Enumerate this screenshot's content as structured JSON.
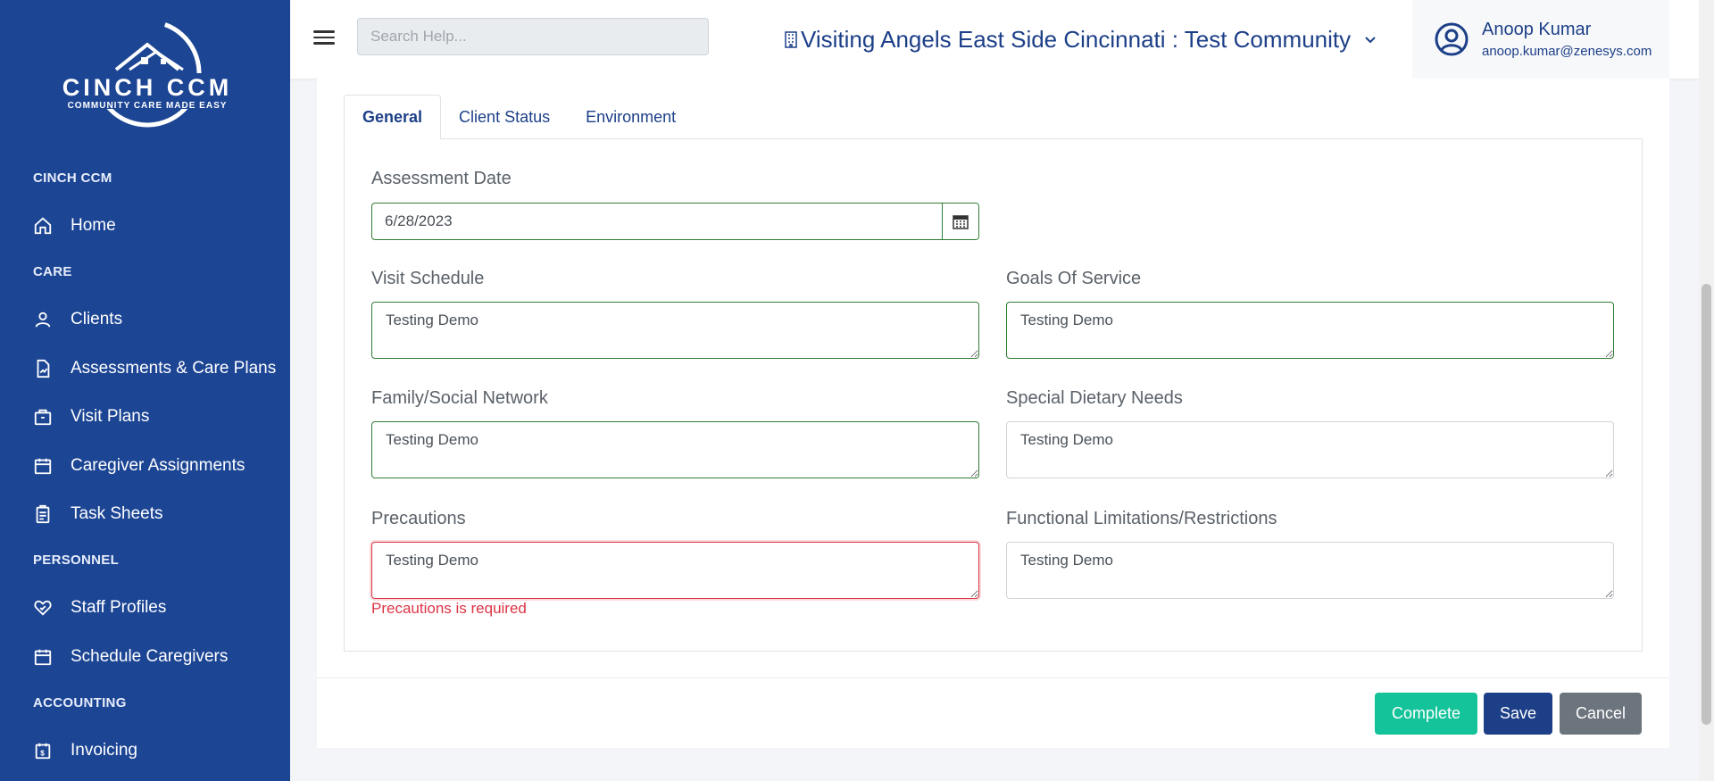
{
  "brand": {
    "logo_name": "CINCH CCM",
    "logo_tagline": "COMMUNITY CARE MADE EASY"
  },
  "sidebar": {
    "sections": {
      "cinch": "CINCH CCM",
      "care": "CARE",
      "personnel": "PERSONNEL",
      "accounting": "ACCOUNTING"
    },
    "items": [
      {
        "label": "Home",
        "icon": "home-icon"
      },
      {
        "label": "Clients",
        "icon": "user-icon"
      },
      {
        "label": "Assessments & Care Plans",
        "icon": "file-chart-icon"
      },
      {
        "label": "Visit Plans",
        "icon": "briefcase-icon"
      },
      {
        "label": "Caregiver Assignments",
        "icon": "calendar-icon"
      },
      {
        "label": "Task Sheets",
        "icon": "clipboard-icon"
      },
      {
        "label": "Staff Profiles",
        "icon": "heart-icon"
      },
      {
        "label": "Schedule Caregivers",
        "icon": "calendar-icon"
      },
      {
        "label": "Invoicing",
        "icon": "invoice-icon"
      }
    ]
  },
  "header": {
    "search_placeholder": "Search Help...",
    "community": "Visiting Angels East Side Cincinnati : Test Community",
    "user_name": "Anoop Kumar",
    "user_email": "anoop.kumar@zenesys.com"
  },
  "tabs": [
    "General",
    "Client Status",
    "Environment"
  ],
  "form": {
    "assessment_date_label": "Assessment Date",
    "assessment_date_value": "6/28/2023",
    "visit_schedule_label": "Visit Schedule",
    "visit_schedule_value": "Testing Demo",
    "goals_label": "Goals Of Service",
    "goals_value": "Testing Demo",
    "family_label": "Family/Social Network",
    "family_value": "Testing Demo",
    "dietary_label": "Special Dietary Needs",
    "dietary_value": "Testing Demo",
    "precautions_label": "Precautions",
    "precautions_value": "Testing Demo",
    "precautions_error": "Precautions is required",
    "functional_label": "Functional Limitations/Restrictions",
    "functional_value": "Testing Demo"
  },
  "buttons": {
    "complete": "Complete",
    "save": "Save",
    "cancel": "Cancel"
  },
  "colors": {
    "sidebar": "#1c4594",
    "accent": "#1c3f88",
    "complete": "#15c39a",
    "cancel": "#6c757d",
    "valid": "#2e7d32",
    "error": "#dc3545"
  }
}
